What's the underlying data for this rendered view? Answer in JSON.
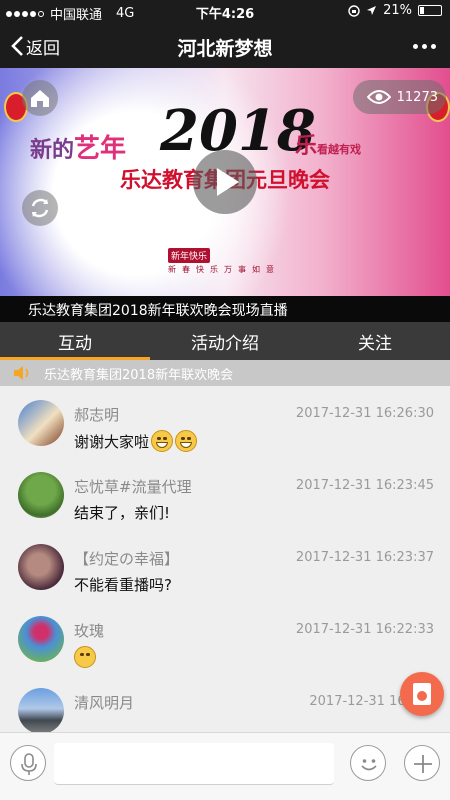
{
  "status_bar": {
    "carrier": "中国联通",
    "network": "4G",
    "time": "下午4:26",
    "battery": "21%",
    "battery_level": 0.21
  },
  "nav": {
    "back_label": "返回",
    "title": "河北新梦想",
    "more_icon": "more-dots-icon"
  },
  "banner": {
    "view_count": "11273",
    "year": "2018",
    "left_text_prefix": "新的",
    "left_text_highlight": "艺年",
    "right_text": "乐",
    "right_text_small": "看越有戏",
    "main_title": "乐达教育集团元旦晚会",
    "stamp": "新年快乐",
    "blessing": "新春快乐万事如意",
    "caption": "乐达教育集团2018新年联欢晚会现场直播"
  },
  "tabs": [
    {
      "label": "互动",
      "active": true
    },
    {
      "label": "活动介绍",
      "active": false
    },
    {
      "label": "关注",
      "active": false
    }
  ],
  "notice": {
    "text": "乐达教育集团2018新年联欢晚会"
  },
  "messages": [
    {
      "name": "郝志明",
      "time": "2017-12-31 16:26:30",
      "text": "谢谢大家啦",
      "emoji_count": 2
    },
    {
      "name": "忘忧草#流量代理",
      "time": "2017-12-31 16:23:45",
      "text": "结束了，亲们!",
      "emoji_count": 0
    },
    {
      "name": "【约定の幸福】",
      "time": "2017-12-31 16:23:37",
      "text": "不能看重播吗?",
      "emoji_count": 0
    },
    {
      "name": "玫瑰",
      "time": "2017-12-31 16:22:33",
      "text": "",
      "emoji_count": 1
    },
    {
      "name": "清风明月",
      "time": "2017-12-31 16:",
      "text": "",
      "emoji_count": 0
    }
  ],
  "input_bar": {
    "placeholder": "",
    "voice_icon": "microphone-icon",
    "emoji_icon": "smiley-icon",
    "plus_icon": "plus-icon"
  },
  "colors": {
    "tab_active_underline": "#f5a623",
    "nav_bg": "#1c1c1c",
    "red_packet": "#f36b4c"
  }
}
